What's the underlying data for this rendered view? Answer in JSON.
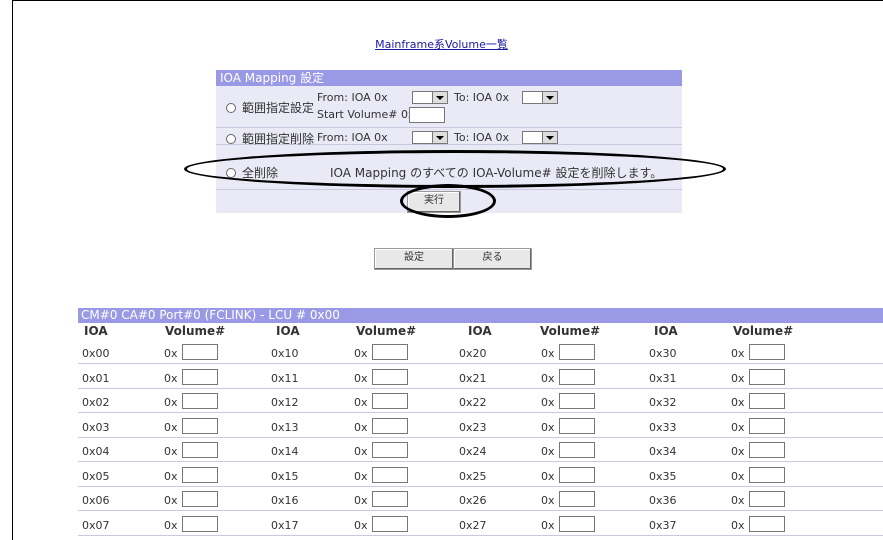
{
  "title_link": "Mainframe系Volume一覧",
  "ioa_mapping": {
    "header": "IOA Mapping 設定",
    "range_set": {
      "label": "範囲指定設定",
      "from_label": "From: IOA 0x",
      "to_label": "To: IOA 0x",
      "start_label": "Start Volume# 0x"
    },
    "range_delete": {
      "label": "範囲指定削除",
      "from_label": "From: IOA 0x",
      "to_label": "To: IOA 0x"
    },
    "delete_all": {
      "label": "全削除",
      "description": "IOA Mapping のすべての IOA-Volume# 設定を削除します。"
    },
    "execute_button": "実行"
  },
  "actions": {
    "set_button": "設定",
    "back_button": "戻る"
  },
  "table": {
    "header": "CM#0 CA#0 Port#0 (FCLINK) - LCU # 0x00",
    "col_ioa": "IOA",
    "col_volume": "Volume#",
    "input_prefix": "0x",
    "columns": [
      [
        "0x00",
        "0x01",
        "0x02",
        "0x03",
        "0x04",
        "0x05",
        "0x06",
        "0x07"
      ],
      [
        "0x10",
        "0x11",
        "0x12",
        "0x13",
        "0x14",
        "0x15",
        "0x16",
        "0x17"
      ],
      [
        "0x20",
        "0x21",
        "0x22",
        "0x23",
        "0x24",
        "0x25",
        "0x26",
        "0x27"
      ],
      [
        "0x30",
        "0x31",
        "0x32",
        "0x33",
        "0x34",
        "0x35",
        "0x36",
        "0x37"
      ]
    ]
  }
}
